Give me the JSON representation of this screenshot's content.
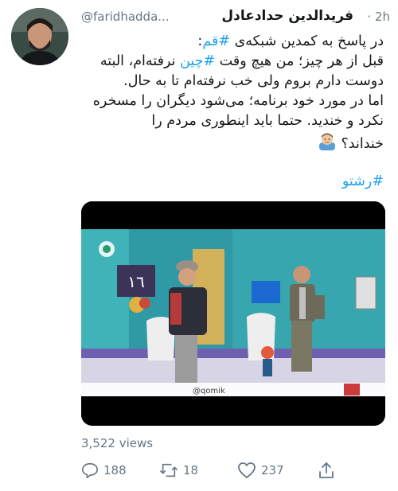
{
  "tweet": {
    "author_name": "فریدالدین حدادعادل",
    "handle": "@faridhadda...",
    "time": "· 2h",
    "lines": [
      [
        "در پاسخ به کمدین شبکه‌ی ",
        "#قم",
        ":"
      ],
      [
        "قبل از هر چیز؛ من هیچ وقت ",
        "#چین",
        " نرفته‌ام، البته"
      ],
      [
        "دوست دارم بروم ولی خب نرفته‌ام تا به حال.",
        "",
        ""
      ],
      [
        "اما در مورد خود برنامه؛ می‌شود دیگران را مسخره",
        "",
        ""
      ],
      [
        "نکرد و خندید. حتما باید اینطوری مردم را",
        "",
        ""
      ],
      [
        "خنداند؟",
        "",
        ""
      ]
    ],
    "emoji_icon": "man-face-emoji-icon",
    "hashtag_line": "#رشتو",
    "media": {
      "type": "video-still",
      "tv_overlay_text": "١٦",
      "channel_text": "@qomik",
      "icons": [
        "tv-logo-icon",
        "ticker-logo-icon"
      ]
    },
    "views": "3,522 views",
    "actions": {
      "replies": "188",
      "retweets": "18",
      "likes": "237"
    }
  },
  "colors": {
    "link": "#1da1f2",
    "secondary_text": "#657786",
    "primary_text": "#14171a"
  }
}
